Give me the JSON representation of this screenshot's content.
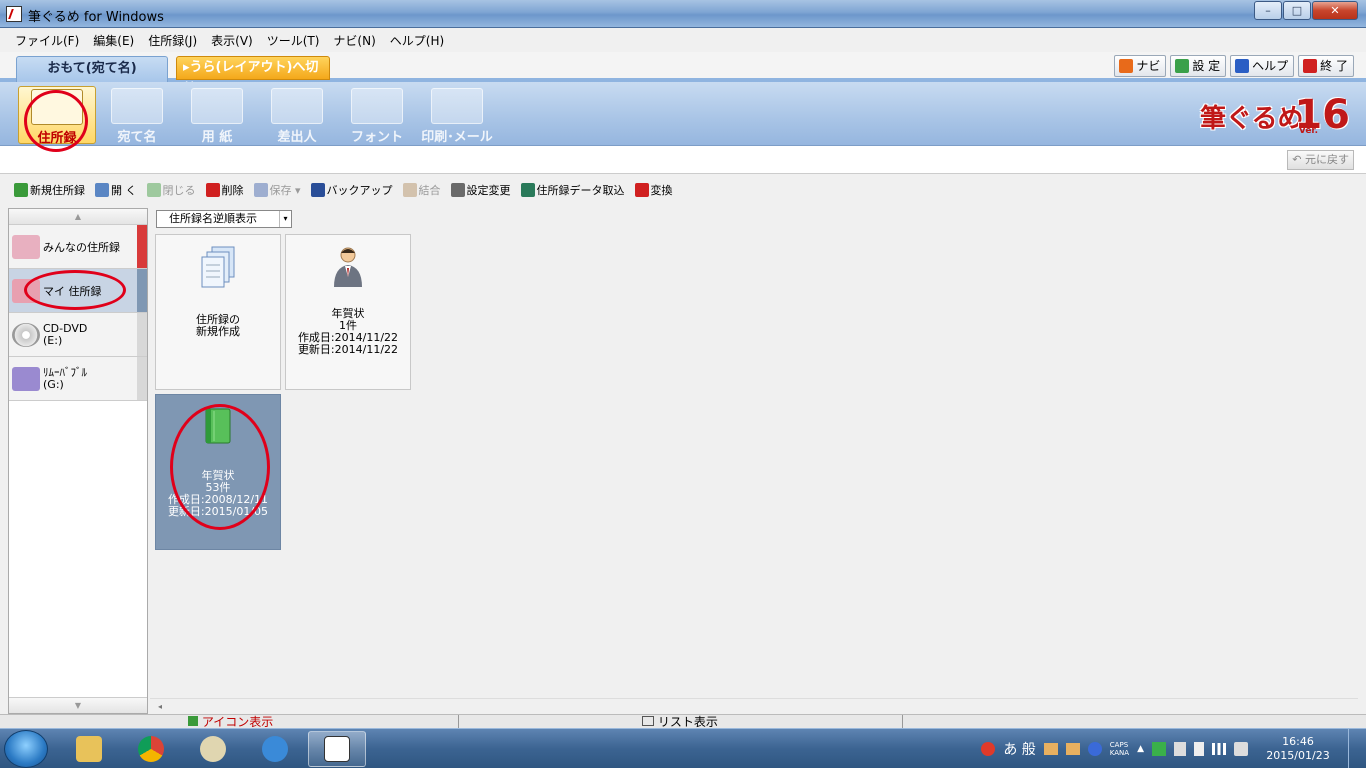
{
  "window": {
    "title": "筆ぐるめ for Windows",
    "controls": {
      "minimize": "–",
      "maximize": "□",
      "close": "✕"
    }
  },
  "menu": [
    "ファイル(F)",
    "編集(E)",
    "住所録(J)",
    "表示(V)",
    "ツール(T)",
    "ナビ(N)",
    "ヘルプ(H)"
  ],
  "tabs": {
    "front": "おもて(宛て名)",
    "back": "▸うら(レイアウト)へ切替"
  },
  "top_buttons": {
    "navi": "ナビ",
    "settings": "設 定",
    "help": "ヘルプ",
    "exit": "終 了"
  },
  "ribbon": {
    "items": [
      "住所録",
      "宛て名",
      "用 紙",
      "差出人",
      "フォント",
      "印刷･メール"
    ],
    "logo_text": "筆ぐるめ",
    "logo_version": "16",
    "logo_ver_label": "Ver."
  },
  "undo_label": "元に戻す",
  "toolbar": [
    {
      "label": "新規住所録",
      "color": "#3a9a3a",
      "enabled": true
    },
    {
      "label": "開 く",
      "color": "#5a86c4",
      "enabled": true
    },
    {
      "label": "閉じる",
      "color": "#3a9a3a",
      "enabled": false
    },
    {
      "label": "削除",
      "color": "#d02020",
      "enabled": true
    },
    {
      "label": "保存 ▾",
      "color": "#3a5ea8",
      "enabled": false
    },
    {
      "label": "バックアップ",
      "color": "#2a4e98",
      "enabled": true
    },
    {
      "label": "結合",
      "color": "#b08a5a",
      "enabled": false
    },
    {
      "label": "設定変更",
      "color": "#6a6a6a",
      "enabled": true
    },
    {
      "label": "住所録データ取込",
      "color": "#2a7a5a",
      "enabled": true
    },
    {
      "label": "変換",
      "color": "#d02020",
      "enabled": true
    }
  ],
  "sidebar": {
    "items": [
      {
        "label": "みんなの住所録",
        "icon": "group-folder-icon",
        "color": "#e0a0b0",
        "bar": "#d83a3a"
      },
      {
        "label": "マイ 住所録",
        "icon": "my-folder-icon",
        "color": "#e8a0b0",
        "bar": "#7f97b3"
      },
      {
        "label": "CD-DVD",
        "label2": "(E:)",
        "icon": "cd-icon",
        "color": "#c8c8c8",
        "bar": "#d8d8d8"
      },
      {
        "label": "ﾘﾑｰﾊﾞﾌﾞﾙ",
        "label2": "(G:)",
        "icon": "removable-drive-icon",
        "color": "#9a8ad0",
        "bar": "#d8d8d8"
      }
    ]
  },
  "sort": {
    "value": "住所録名逆順表示"
  },
  "cards": [
    {
      "line1": "住所録の",
      "line2": "新規作成"
    },
    {
      "name": "年賀状",
      "count": "1件",
      "created": "作成日:2014/11/22",
      "updated": "更新日:2014/11/22"
    },
    {
      "name": "年賀状",
      "count": "53件",
      "created": "作成日:2008/12/11",
      "updated": "更新日:2015/01/05"
    }
  ],
  "bottom": {
    "icon_view": "アイコン表示",
    "list_view": "リスト表示"
  },
  "taskbar": {
    "ime": "あ 般",
    "caps": "CAPS",
    "kana": "KANA",
    "time": "16:46",
    "date": "2015/01/23"
  }
}
